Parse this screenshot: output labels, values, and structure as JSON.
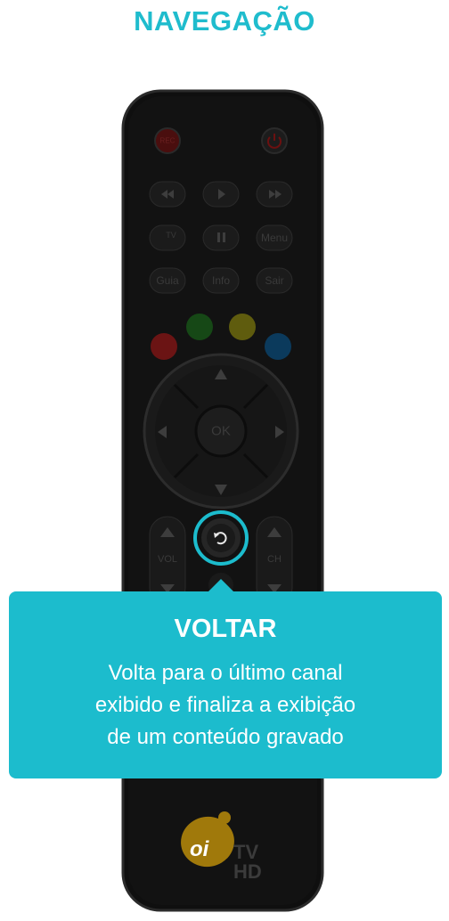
{
  "page": {
    "title": "NAVEGAÇÃO"
  },
  "remote": {
    "rec_label": "REC",
    "power_icon": "power-icon",
    "rewind_icon": "rewind-icon",
    "play_icon": "play-icon",
    "fastforward_icon": "fast-forward-icon",
    "tv_label": "TV",
    "pause_icon": "pause-icon",
    "menu_label": "Menu",
    "guia_label": "Guia",
    "info_label": "Info",
    "sair_label": "Sair",
    "color_buttons": [
      "#8a1a1a",
      "#1a5a1a",
      "#7a7a10",
      "#0d4d7a"
    ],
    "ok_label": "OK",
    "vol_label": "VOL",
    "ch_label": "CH",
    "back_icon": "back-icon",
    "mute_icon": "mute-icon"
  },
  "tooltip": {
    "title": "VOLTAR",
    "lines": [
      "Volta para o último canal",
      "exibido e finaliza a exibição",
      "de um conteúdo gravado"
    ]
  },
  "logo": {
    "oi": "oi",
    "tv": "TV",
    "hd": "HD"
  },
  "colors": {
    "accent": "#1cbccd",
    "remote_body": "#111111",
    "logo_yellow": "#a87f0a"
  }
}
